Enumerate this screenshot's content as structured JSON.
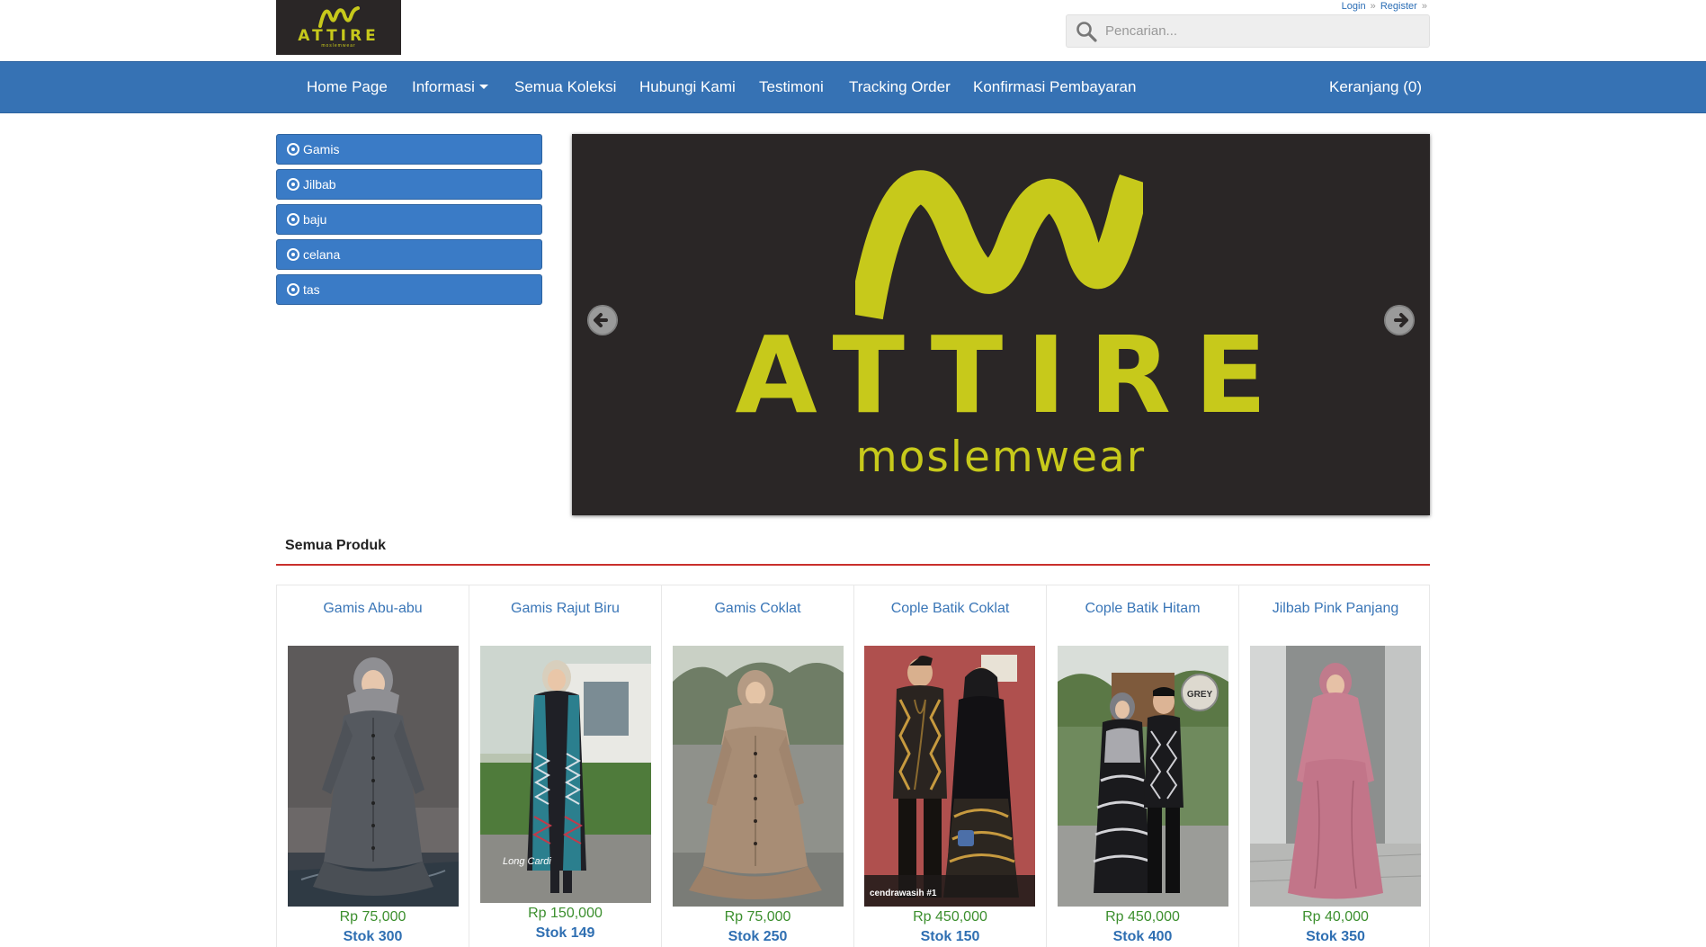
{
  "header": {
    "logo": {
      "word": "ATTIRE",
      "sub": "moslemwear"
    },
    "auth": {
      "login": "Login",
      "register": "Register",
      "separator": "»"
    },
    "search": {
      "placeholder": "Pencarian...",
      "value": ""
    }
  },
  "nav": {
    "items": [
      {
        "label": "Home Page"
      },
      {
        "label": "Informasi"
      },
      {
        "label": "Semua Koleksi"
      },
      {
        "label": "Hubungi Kami"
      },
      {
        "label": "Testimoni"
      },
      {
        "label": "Tracking Order"
      },
      {
        "label": "Konfirmasi Pembayaran"
      }
    ],
    "cart": "Keranjang (0)"
  },
  "sidebar": {
    "categories": [
      {
        "label": "Gamis"
      },
      {
        "label": "Jilbab"
      },
      {
        "label": "baju"
      },
      {
        "label": "celana"
      },
      {
        "label": "tas"
      }
    ]
  },
  "banner": {
    "word": "ATTIRE",
    "sub": "moslemwear"
  },
  "products": {
    "title": "Semua Produk",
    "items": [
      {
        "name": "Gamis Abu-abu",
        "price": "Rp 75,000",
        "stock": "Stok 300",
        "image_label": ""
      },
      {
        "name": "Gamis Rajut Biru",
        "price": "Rp 150,000",
        "stock": "Stok 149",
        "image_label": "Long Cardi"
      },
      {
        "name": "Gamis Coklat",
        "price": "Rp 75,000",
        "stock": "Stok 250",
        "image_label": ""
      },
      {
        "name": "Cople Batik Coklat",
        "price": "Rp 450,000",
        "stock": "Stok 150",
        "image_label": "cendrawasih #1"
      },
      {
        "name": "Cople Batik Hitam",
        "price": "Rp 450,000",
        "stock": "Stok 400",
        "image_label": "GREY"
      },
      {
        "name": "Jilbab Pink Panjang",
        "price": "Rp 40,000",
        "stock": "Stok 350",
        "image_label": ""
      }
    ]
  },
  "colors": {
    "brand": "#3672b4",
    "logo": "#c7c91b",
    "banner_bg": "#2a2626",
    "price": "#3c8f2e",
    "divider": "#c9302c"
  }
}
